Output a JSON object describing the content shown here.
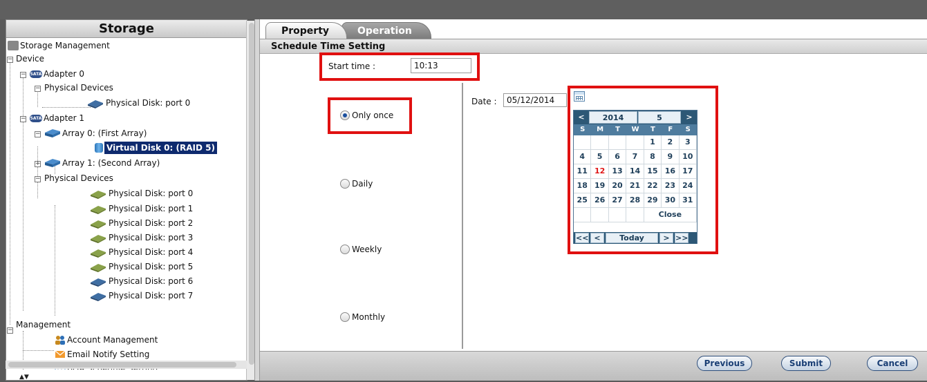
{
  "left_panel": {
    "title": "Storage",
    "tree": {
      "storage_management": "Storage Management",
      "device": "Device",
      "adapter0": "Adapter 0",
      "adapter_badge": "SATA",
      "a0_physical_devices": "Physical Devices",
      "a0_disk_port0": "Physical Disk: port 0",
      "adapter1": "Adapter 1",
      "array0": "Array 0: (First Array)",
      "virtual_disk0": "Virtual Disk 0: (RAID 5)",
      "array1": "Array 1: (Second Array)",
      "a1_physical_devices": "Physical Devices",
      "a1_disks": [
        "Physical Disk: port 0",
        "Physical Disk: port 1",
        "Physical Disk: port 2",
        "Physical Disk: port 3",
        "Physical Disk: port 4",
        "Physical Disk: port 5",
        "Physical Disk: port 6",
        "Physical Disk: port 7"
      ],
      "management": "Management",
      "account_management": "Account Management",
      "email_notify": "Email Notify Setting",
      "bga_schedule": "BGA Schedule Setting"
    }
  },
  "tabs": {
    "property": "Property",
    "operation": "Operation"
  },
  "section_title": "Schedule Time Setting",
  "form": {
    "start_time_label": "Start time :",
    "start_time_value": "10:13",
    "date_label": "Date :",
    "date_value": "05/12/2014",
    "options": [
      "Only once",
      "Daily",
      "Weekly",
      "Monthly"
    ],
    "selected_option": "Only once"
  },
  "calendar": {
    "prev": "<",
    "next": ">",
    "year": "2014",
    "month": "5",
    "weekdays": [
      "S",
      "M",
      "T",
      "W",
      "T",
      "F",
      "S"
    ],
    "days": [
      "",
      "",
      "",
      "",
      "1",
      "2",
      "3",
      "4",
      "5",
      "6",
      "7",
      "8",
      "9",
      "10",
      "11",
      "12",
      "13",
      "14",
      "15",
      "16",
      "17",
      "18",
      "19",
      "20",
      "21",
      "22",
      "23",
      "24",
      "25",
      "26",
      "27",
      "28",
      "29",
      "30",
      "31"
    ],
    "today": "12",
    "close": "Close",
    "nav_prev_year": "<<",
    "nav_prev_month": "<",
    "today_btn": "Today",
    "nav_next_month": ">",
    "nav_next_year": ">>"
  },
  "buttons": {
    "previous": "Previous",
    "submit": "Submit",
    "cancel": "Cancel"
  },
  "colors": {
    "highlight_red": "#e01010",
    "selection_navy": "#0e2a6e",
    "calendar_header": "#2d5876",
    "today_red": "#e01818"
  }
}
